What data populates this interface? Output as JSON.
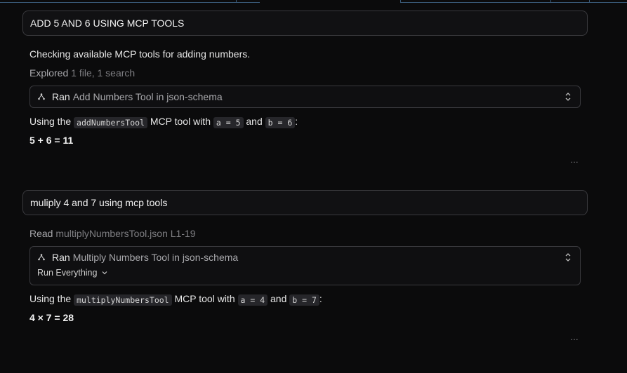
{
  "conversation": [
    {
      "prompt": "ADD 5 AND 6 USING MCP TOOLS",
      "status": "Checking available MCP tools for adding numbers.",
      "explored": {
        "label": "Explored",
        "detail": "1 file, 1 search"
      },
      "tool": {
        "verb": "Ran",
        "name": "Add Numbers Tool in json-schema"
      },
      "using": {
        "prefix": "Using the",
        "tool_code": "addNumbersTool",
        "mid": "MCP tool with",
        "arg_a": "a = 5",
        "and": "and",
        "arg_b": "b = 6",
        "suffix": ":"
      },
      "result": "5 + 6 = 11",
      "more": "…"
    },
    {
      "prompt": "muliply 4 and 7 using mcp tools",
      "read": {
        "label": "Read",
        "detail": "multiplyNumbersTool.json L1-19"
      },
      "tool": {
        "verb": "Ran",
        "name": "Multiply Numbers Tool in json-schema",
        "run_mode": "Run Everything"
      },
      "using": {
        "prefix": "Using the",
        "tool_code": "multiplyNumbersTool",
        "mid": "MCP tool with",
        "arg_a": "a = 4",
        "and": "and",
        "arg_b": "b = 7",
        "suffix": ":"
      },
      "result": "4 × 7 = 28",
      "more": "…"
    }
  ],
  "colors": {
    "background": "#0b0b0c",
    "border": "#3a3a3e",
    "muted": "#9a9a9e",
    "accent_line": "#3a5b7a"
  },
  "icons": {
    "tool": "mcp-tool-icon",
    "expand": "expand-collapse-chevron-icon",
    "dropdown": "chevron-down-icon",
    "more": "more-dots-icon"
  }
}
